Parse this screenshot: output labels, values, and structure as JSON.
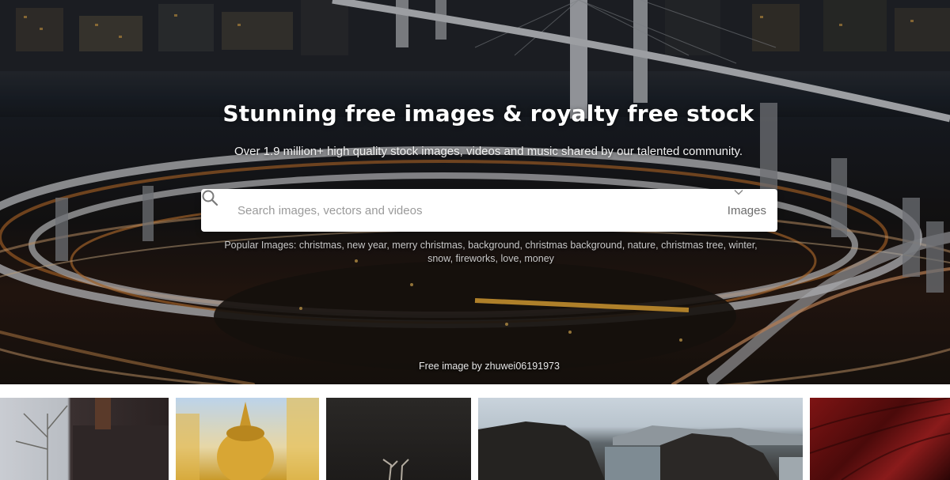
{
  "hero": {
    "title": "Stunning free images & royalty free stock",
    "subtitle": "Over 1.9 million+ high quality stock images, videos and music shared by our talented community.",
    "background_image": "city highway interchange at night",
    "credit_prefix": "Free image by",
    "credit_author": "zhuwei06191973"
  },
  "search": {
    "placeholder": "Search images, vectors and videos",
    "value": "",
    "type_selected": "Images",
    "search_icon": "search-icon",
    "chevron_icon": "chevron-down-icon"
  },
  "popular": {
    "prefix": "Popular Images:",
    "tags": [
      "christmas",
      "new year",
      "merry christmas",
      "background",
      "christmas background",
      "nature",
      "christmas tree",
      "winter",
      "snow",
      "fireworks",
      "love",
      "money"
    ]
  },
  "gallery": {
    "thumbnails": [
      {
        "alt": "tree and building"
      },
      {
        "alt": "golden buddha statue"
      },
      {
        "alt": "deer antlers"
      },
      {
        "alt": "rocky coast"
      },
      {
        "alt": "red abstract"
      }
    ]
  },
  "colors": {
    "search_background": "#ffffff",
    "title_text": "#ffffff",
    "popular_text": "#c9c9c9",
    "placeholder_text": "#9a9a9a"
  }
}
